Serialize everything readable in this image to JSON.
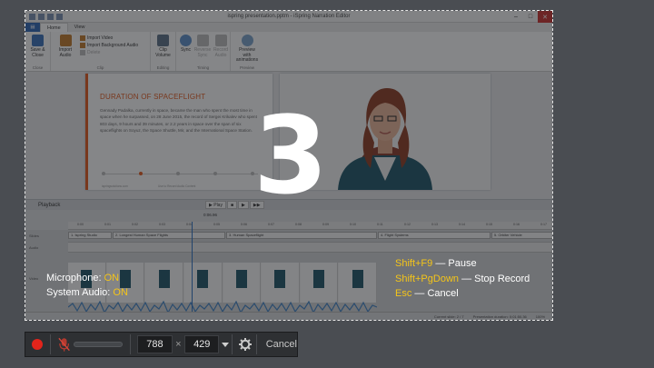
{
  "app": {
    "window_title": "ispring presentation.pptm - iSpring Narration Editor",
    "tabs": [
      "Home",
      "View"
    ],
    "active_tab": "Home",
    "ribbon": {
      "save_close": "Save & Close",
      "import_audio": "Import Audio",
      "import_video": "Import Video",
      "import_bg_audio": "Import Background Audio",
      "delete": "Delete",
      "clip_volume": "Clip Volume",
      "sync": "Sync",
      "reverse_sync": "Reverse Sync",
      "record_audio": "Record Audio",
      "record_video": "Record Video",
      "preview": "Preview with animations",
      "groups": [
        "Close",
        "Clip",
        "Editing",
        "Timing",
        "Preview"
      ]
    },
    "slide": {
      "title": "DURATION OF SPACEFLIGHT",
      "body": "Gennady Padalka, currently in space, became the man who spent the most time in space when he surpassed, on 28 June 2015, the record of Sergei Krikalev who spent 803 days, 9 hours and 39 minutes, or 2.2 years in space over the span of six spaceflights on Soyuz, the Space Shuttle, Mir, and the International Space Station.",
      "footer_left": "ispringsolutions.com",
      "footer_right": "Use to Record Audio Content"
    },
    "playback_label": "Playback",
    "play_button": "Play",
    "timecode": "0:06.96",
    "ruler_ticks": [
      "0:00",
      "0:01",
      "0:02",
      "0:03",
      "0:04",
      "0:05",
      "0:06",
      "0:07",
      "0:08",
      "0:09",
      "0:10",
      "0:11",
      "0:12",
      "0:13",
      "0:14",
      "0:15",
      "0:16",
      "0:17"
    ],
    "track_labels": [
      "Slides",
      "Audio",
      "Video"
    ],
    "slide_segments": [
      "1. Ispring Studio",
      "2. Longest Human Space Flights",
      "3. Human Spaceflight",
      "4. Flight Systems",
      "5. Orbiter Vehicle"
    ],
    "status": {
      "current_slide": "Current slide: 2 / 7",
      "duration": "Presentation duration: 0:01:50.36",
      "zoom": "100%"
    }
  },
  "overlay": {
    "countdown": "3",
    "microphone_label": "Microphone:",
    "microphone_value": "ON",
    "system_audio_label": "System Audio:",
    "system_audio_value": "ON",
    "hotkeys": [
      {
        "key": "Shift+F9",
        "action": "— Pause"
      },
      {
        "key": "Shift+PgDown",
        "action": "— Stop Record"
      },
      {
        "key": "Esc",
        "action": "— Cancel"
      }
    ]
  },
  "toolbar": {
    "width": "788",
    "times": "×",
    "height": "429",
    "cancel_label": "Cancel",
    "record_icon": "record-icon",
    "mic_icon": "microphone-muted-icon",
    "settings_icon": "gear-icon"
  },
  "colors": {
    "accent_yellow": "#f5c518",
    "record_red": "#e2241b",
    "slide_orange": "#e2591d"
  }
}
